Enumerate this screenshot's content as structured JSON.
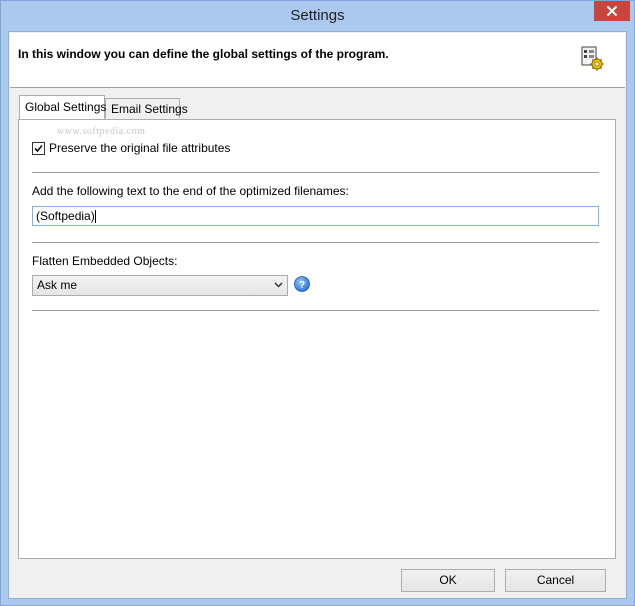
{
  "window": {
    "title": "Settings"
  },
  "header": {
    "description": "In this window you can define the global settings of the program."
  },
  "tabs": [
    {
      "label": "Global Settings",
      "active": true
    },
    {
      "label": "Email Settings",
      "active": false
    }
  ],
  "global_settings": {
    "watermark": "www.softpedia.com",
    "preserve_attributes": {
      "label": "Preserve the original file attributes",
      "checked": true
    },
    "suffix": {
      "label": "Add the following text to the end of the optimized filenames:",
      "value": "(Softpedia)"
    },
    "flatten": {
      "label": "Flatten Embedded Objects:",
      "selected": "Ask me"
    }
  },
  "buttons": {
    "ok": "OK",
    "cancel": "Cancel"
  },
  "icons": {
    "close": "close-icon",
    "settings": "settings-gear-icon",
    "help": "help-icon"
  },
  "colors": {
    "titlebar": "#ABC8EE",
    "close_button": "#C7453C",
    "focus_border": "#7EB4EA",
    "help_icon": "#2A72C8"
  }
}
